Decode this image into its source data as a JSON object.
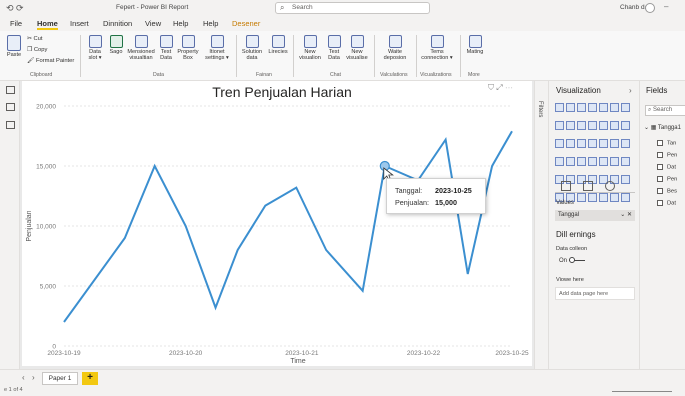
{
  "titlebar": {
    "window_title": "Fepert - Power BI Report",
    "search_placeholder": "Search",
    "user": "Chanb data"
  },
  "menu": {
    "tabs": [
      "File",
      "Home",
      "Insert",
      "Dinnition",
      "View",
      "Help",
      "Help",
      "Desener"
    ]
  },
  "ribbon": {
    "paste": "Paste",
    "cut": "Cut",
    "copy": "Copy",
    "format_painter": "Format Painter",
    "clipboard_group": "Clipboard",
    "buttons": [
      {
        "label": "Data\nslot ▾",
        "icon": "database-icon"
      },
      {
        "label": "Sago",
        "icon": "excel-icon"
      },
      {
        "label": "Mensioned\nvisualtian",
        "icon": "people-icon"
      },
      {
        "label": "Test\nData",
        "icon": "document-icon"
      },
      {
        "label": "Property\nBox",
        "icon": "table-icon"
      },
      {
        "label": "Itionet\nsettings ▾",
        "icon": "grid-icon"
      },
      {
        "label": "Solution\ndata",
        "icon": "solution-icon"
      },
      {
        "label": "Lirecies",
        "icon": "refresh-icon"
      },
      {
        "label": "New\nvisualion",
        "icon": "bar-chart-icon"
      },
      {
        "label": "Test\nData",
        "icon": "text-box-icon"
      },
      {
        "label": "New\nvisualise",
        "icon": "visual-icon"
      },
      {
        "label": "Waite\ndeposion",
        "icon": "calc-icon"
      },
      {
        "label": "Tems\nconnection ▾",
        "icon": "connection-icon"
      },
      {
        "label": "Mating",
        "icon": "share-icon"
      }
    ],
    "groups": [
      "Clipboard",
      "Data",
      "Fainan",
      "Chat",
      "Valculations",
      "Vicualizations",
      "More"
    ]
  },
  "chart_data": {
    "type": "line",
    "title": "Tren Penjualan Harian",
    "xlabel": "Time",
    "ylabel": "Penjualan",
    "x_ticks": [
      "2023-10-19",
      "2023-10-20",
      "2023-10-21",
      "2023-10-22",
      "2023-10-25"
    ],
    "y_ticks": [
      "0",
      "5,000",
      "10,000",
      "15,000",
      "20,000"
    ],
    "ylim": [
      0,
      20000
    ],
    "series": [
      {
        "x": [
          0.0,
          0.55,
          0.82,
          1.1,
          1.37,
          1.57,
          1.82,
          2.1,
          2.37,
          2.7,
          2.9,
          3.2,
          3.45,
          3.65,
          3.87,
          4.05
        ],
        "values": [
          2000,
          9000,
          15000,
          10000,
          3200,
          8000,
          11700,
          13200,
          8000,
          4600,
          15000,
          13800,
          17200,
          6000,
          15000,
          17900
        ],
        "color": "#3b8fd0"
      }
    ],
    "highlighted_point": {
      "x": 2.9,
      "value": 15000
    }
  },
  "tooltip": {
    "date_label": "Tanggal:",
    "date_value": "2023-10-25",
    "sales_label": "Penjualan:",
    "sales_value": "15,000"
  },
  "filters_label": "Filters",
  "viz_pane": {
    "title": "Visualization",
    "values_label": "Values",
    "field_well": "Tanggal",
    "drill_title": "Dill ernings",
    "cross_label": "Data colleon",
    "onoff_label": "On",
    "keep_label": "Viowe here",
    "drill_placeholder": "Add data page here"
  },
  "fields_pane": {
    "title": "Fields",
    "search_placeholder": "Search",
    "table": "Tangga1",
    "fields": [
      "Tan",
      "Pen",
      "Dat",
      "Pen",
      "Bes",
      "Dat"
    ]
  },
  "pagebar": {
    "page_tab": "Paper 1",
    "add": "+",
    "status": "e 1 of 4"
  }
}
